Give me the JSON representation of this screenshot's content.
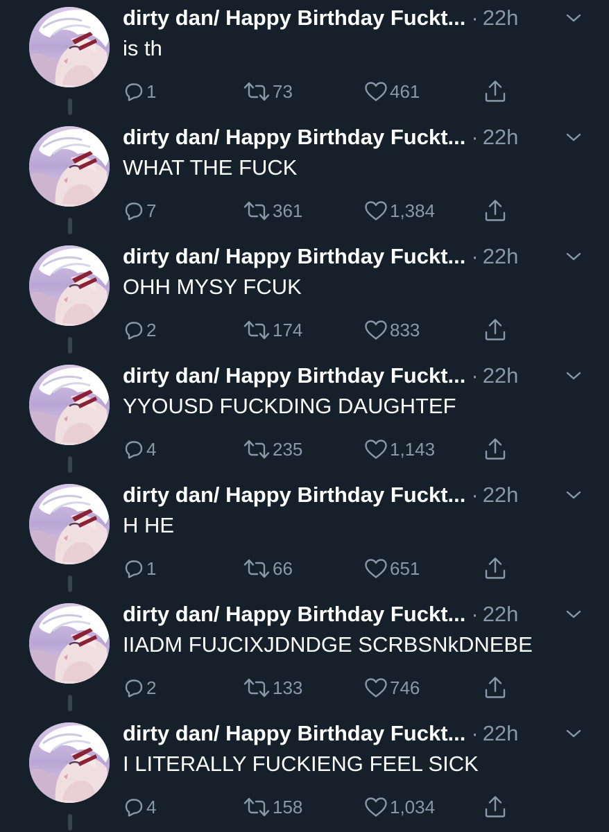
{
  "colors": {
    "background": "#15202b",
    "text_primary": "#ffffff",
    "text_secondary": "#8899a6",
    "thread_line": "#38444d"
  },
  "icons": {
    "reply": "reply-icon",
    "retweet": "retweet-icon",
    "like": "like-icon",
    "share": "share-icon",
    "menu": "chevron-down-icon"
  },
  "tweets": [
    {
      "name": "dirty dan/ Happy Birthday Fuckt...",
      "time": "22h",
      "text": "is th",
      "replies": "1",
      "retweets": "73",
      "likes": "461"
    },
    {
      "name": "dirty dan/ Happy Birthday Fuckt...",
      "time": "22h",
      "text": "WHAT THE FUCK",
      "replies": "7",
      "retweets": "361",
      "likes": "1,384"
    },
    {
      "name": "dirty dan/ Happy Birthday Fuckt...",
      "time": "22h",
      "text": "OHH MYSY FCUK",
      "replies": "2",
      "retweets": "174",
      "likes": "833"
    },
    {
      "name": "dirty dan/ Happy Birthday Fuckt...",
      "time": "22h",
      "text": "YYOUSD FUCKDING DAUGHTEF",
      "replies": "4",
      "retweets": "235",
      "likes": "1,143"
    },
    {
      "name": "dirty dan/ Happy Birthday Fuckt...",
      "time": "22h",
      "text": "H HE",
      "replies": "1",
      "retweets": "66",
      "likes": "651"
    },
    {
      "name": "dirty dan/ Happy Birthday Fuckt...",
      "time": "22h",
      "text": "IIADM FUJCIXJDNDGE SCRBSNkDNEBE",
      "replies": "2",
      "retweets": "133",
      "likes": "746"
    },
    {
      "name": "dirty dan/ Happy Birthday Fuckt...",
      "time": "22h",
      "text": "I LITERALLY FUCKIENG FEEL SICK",
      "replies": "4",
      "retweets": "158",
      "likes": "1,034"
    }
  ]
}
